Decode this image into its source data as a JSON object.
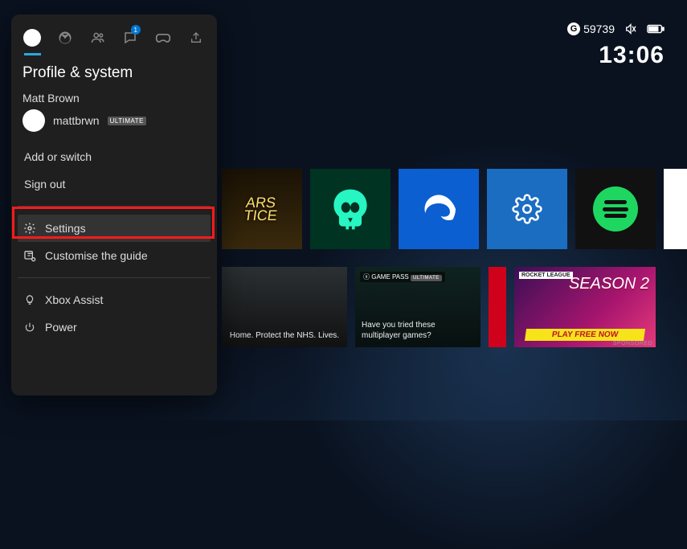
{
  "status_bar": {
    "gamerscore": "59739",
    "gamerscore_prefix": "G",
    "clock": "13:06",
    "mute_icon": "mute-icon",
    "battery_icon": "battery-icon"
  },
  "guide": {
    "title": "Profile & system",
    "tabs": [
      {
        "id": "profile",
        "icon": "avatar-icon",
        "active": true
      },
      {
        "id": "xbox",
        "icon": "xbox-icon",
        "active": false
      },
      {
        "id": "people",
        "icon": "people-icon",
        "active": false
      },
      {
        "id": "chat",
        "icon": "chat-icon",
        "active": false,
        "badge": "1"
      },
      {
        "id": "library",
        "icon": "controller-icon",
        "active": false
      },
      {
        "id": "share",
        "icon": "share-icon",
        "active": false
      }
    ],
    "profile": {
      "display_name": "Matt Brown",
      "gamertag": "mattbrwn",
      "subscription_badge": "ULTIMATE"
    },
    "menu_top": [
      {
        "id": "add-switch",
        "label": "Add or switch",
        "icon": null
      },
      {
        "id": "sign-out",
        "label": "Sign out",
        "icon": null
      }
    ],
    "menu_mid": [
      {
        "id": "settings",
        "label": "Settings",
        "icon": "gear-icon",
        "selected": true
      },
      {
        "id": "customise",
        "label": "Customise the guide",
        "icon": "customise-icon",
        "selected": false
      }
    ],
    "menu_bottom": [
      {
        "id": "assist",
        "label": "Xbox Assist",
        "icon": "bulb-icon"
      },
      {
        "id": "power",
        "label": "Power",
        "icon": "power-icon"
      }
    ]
  },
  "home": {
    "row1": [
      {
        "id": "cars",
        "title": "ARS",
        "subtitle": "TICE"
      },
      {
        "id": "sea-of-thieves",
        "icon": "skull-icon"
      },
      {
        "id": "edge",
        "icon": "edge-icon"
      },
      {
        "id": "console-settings",
        "icon": "gear-icon"
      },
      {
        "id": "spotify",
        "icon": "spotify-icon"
      },
      {
        "id": "microsoft-store",
        "icon": "store-icon"
      }
    ],
    "row2": [
      {
        "id": "nhs-ad",
        "caption": "Home. Protect the NHS.\nLives."
      },
      {
        "id": "game-pass-ad",
        "header": "GAME PASS",
        "header_badge": "ULTIMATE",
        "caption": "Have you tried these multiplayer games?"
      },
      {
        "id": "red-accent"
      },
      {
        "id": "rocket-league-ad",
        "corner": "ROCKET LEAGUE",
        "title": "SEASON 2",
        "cta": "PLAY FREE NOW",
        "sponsored_label": "SPONSORED"
      }
    ]
  },
  "annotation": {
    "highlighted_item": "settings"
  }
}
